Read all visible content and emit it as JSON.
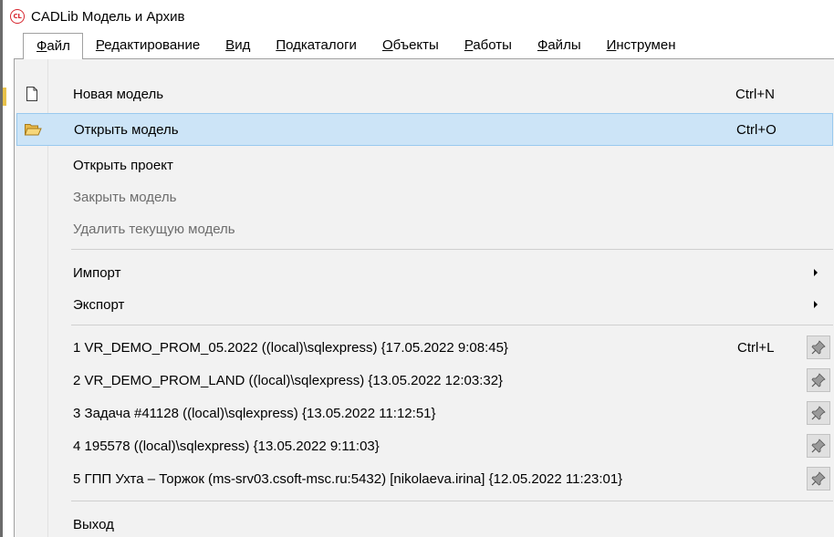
{
  "window": {
    "app_logo_text": "CL",
    "title": "CADLib Модель и Архив"
  },
  "menubar": {
    "items": [
      {
        "label": "Файл",
        "mnemonic": "Ф",
        "rest": "айл"
      },
      {
        "label": "Редактирование",
        "mnemonic": "Р",
        "rest": "едактирование"
      },
      {
        "label": "Вид",
        "mnemonic": "В",
        "rest": "ид"
      },
      {
        "label": "Подкаталоги",
        "mnemonic": "П",
        "rest": "одкаталоги"
      },
      {
        "label": "Объекты",
        "mnemonic": "О",
        "rest": "бъекты"
      },
      {
        "label": "Работы",
        "mnemonic": "Р",
        "rest": "аботы"
      },
      {
        "label": "Файлы",
        "mnemonic": "Ф",
        "rest": "айлы"
      },
      {
        "label": "Инструмен",
        "mnemonic": "И",
        "rest": "нструмен"
      }
    ]
  },
  "file_menu": {
    "new_model": {
      "label": "Новая модель",
      "shortcut": "Ctrl+N",
      "icon": "new-document-icon"
    },
    "open_model": {
      "label": "Открыть модель",
      "shortcut": "Ctrl+O",
      "icon": "open-folder-icon"
    },
    "open_project": {
      "label": "Открыть проект"
    },
    "close_model": {
      "label": "Закрыть модель",
      "disabled": true
    },
    "delete_model": {
      "label": "Удалить текущую модель",
      "disabled": true
    },
    "import": {
      "label": "Импорт",
      "submenu": true
    },
    "export": {
      "label": "Экспорт",
      "submenu": true
    },
    "recent": [
      {
        "label": "1 VR_DEMO_PROM_05.2022 ((local)\\sqlexpress) {17.05.2022 9:08:45}",
        "shortcut": "Ctrl+L"
      },
      {
        "label": "2 VR_DEMO_PROM_LAND ((local)\\sqlexpress) {13.05.2022 12:03:32}"
      },
      {
        "label": "3 Задача #41128 ((local)\\sqlexpress) {13.05.2022 11:12:51}"
      },
      {
        "label": "4 195578 ((local)\\sqlexpress) {13.05.2022 9:11:03}"
      },
      {
        "label": "5 ГПП Ухта – Торжок (ms-srv03.csoft-msc.ru:5432) [nikolaeva.irina] {12.05.2022 11:23:01}"
      }
    ],
    "exit": {
      "label": "Выход"
    }
  },
  "colors": {
    "hover_bg": "#cce4f7",
    "hover_border": "#99c9ef",
    "menu_bg": "#f2f2f2",
    "disabled_text": "#6d6d6d",
    "logo_red": "#d7262f"
  }
}
